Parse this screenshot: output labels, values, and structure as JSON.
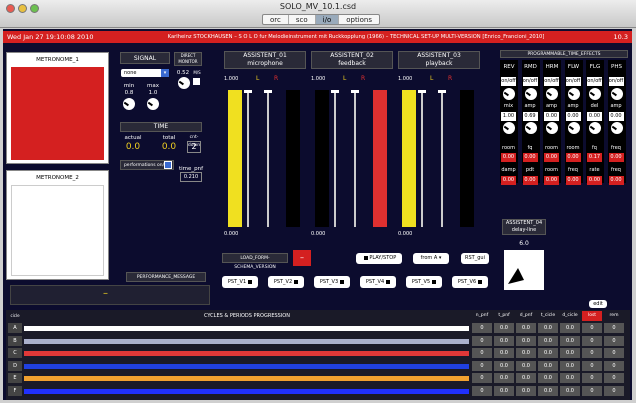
{
  "window": {
    "title": "SOLO_MV_10.1.csd",
    "tabs": [
      "orc",
      "sco",
      "i/o",
      "options"
    ],
    "active_tab": "i/o"
  },
  "header": {
    "date": "Wed Jan 27 19:10:08 2010",
    "title": "Karlheinz STOCKHAUSEN – S O L O  fur Melodieinstrument mit Ruckkopplung (1966) – TECHNICAL SET-UP MULTI-VERSION [Enrico_Francioni_2010]",
    "version": "10.3"
  },
  "metronome1": {
    "label": "METRONOME_1",
    "color": "#d42020"
  },
  "metronome2": {
    "label": "METRONOME_2",
    "color": "#ffffff"
  },
  "signal": {
    "label": "SIGNAL",
    "select": "none",
    "min_label": "min",
    "max_label": "max",
    "min": "0.8",
    "max": "1.0"
  },
  "direct_monitor": {
    "label": "DIRECT MONITOR",
    "value": "0.52",
    "toggle": "M/S"
  },
  "time": {
    "label": "TIME",
    "actual_label": "actual",
    "total_label": "total",
    "countdown_label": "cnt-down",
    "actual": "0.0",
    "total": "0.0",
    "countdown": "2",
    "perf_label": "performations on/off",
    "time_pnf_label": "time_pnf",
    "time_pnf": "0.210"
  },
  "assistants": [
    {
      "title": "ASSISTENT_01",
      "subtitle": "microphone",
      "scale": "1.000",
      "l": "L",
      "r": "R",
      "level": 0
    },
    {
      "title": "ASSISTENT_02",
      "subtitle": "feedback",
      "scale": "1.000",
      "l": "L",
      "r": "R",
      "level": 0
    },
    {
      "title": "ASSISTENT_03",
      "subtitle": "playback",
      "scale": "1.000",
      "l": "L",
      "r": "R",
      "level": 0
    }
  ],
  "meters": {
    "zero": "0.000"
  },
  "fx": {
    "title": "PROGRAMMABLE_TIME_EFFECTS",
    "cols": [
      "REV",
      "RMD",
      "HRM",
      "FLW",
      "FLG",
      "PHS"
    ],
    "r1": [
      "on/off",
      "on/off",
      "on/off",
      "on/off",
      "on/off",
      "on/off"
    ],
    "r2": [
      "mix",
      "amp",
      "amp",
      "amp",
      "del",
      "amp"
    ],
    "r3": [
      "1.00",
      "0.69",
      "0.00",
      "0.00",
      "0.00",
      "0.00"
    ],
    "r4": [
      "room",
      "fq",
      "room",
      "room",
      "fq",
      "freq"
    ],
    "r5": [
      "0.00",
      "0.00",
      "0.00",
      "0.00",
      "0.17",
      "0.00"
    ],
    "r6": [
      "damp",
      "pdt",
      "room",
      "freq",
      "rate",
      "freq"
    ],
    "r7": [
      "0.00",
      "0.00",
      "0.00",
      "0.00",
      "0.00",
      "0.00"
    ]
  },
  "delay": {
    "title": "ASSISTENT_04",
    "subtitle": "delay-line",
    "value": "6.0"
  },
  "load_label": "LOAD_FORM-SCHEMA_VERSION",
  "play_label": "PLAY/STOP",
  "from_label": "from A",
  "rst_label": "RST_gui",
  "presets": [
    "PST_V1",
    "PST_V2",
    "PST_V3",
    "PST_V4",
    "PST_V5",
    "PST_V6"
  ],
  "perf_msg": {
    "label": "PERFORMANCE_MESSAGE",
    "value": "–"
  },
  "edit_label": "edit",
  "table": {
    "head0": "cicle",
    "head1": "CYCLES & PERIODS PROGRESSION",
    "cols": [
      "n_pnf",
      "t_pnf",
      "d_pnf",
      "t_cicle",
      "d_cicle",
      "lost",
      "rem"
    ],
    "rows": [
      {
        "id": "A",
        "color": "#ffffff",
        "vals": [
          "0",
          "0.0",
          "0.0",
          "0.0",
          "0.0",
          "0",
          "0"
        ]
      },
      {
        "id": "B",
        "color": "#aab0cc",
        "vals": [
          "0",
          "0.0",
          "0.0",
          "0.0",
          "0.0",
          "0",
          "0"
        ]
      },
      {
        "id": "C",
        "color": "#e03838",
        "vals": [
          "0",
          "0.0",
          "0.0",
          "0.0",
          "0.0",
          "0",
          "0"
        ]
      },
      {
        "id": "D",
        "color": "#2040e0",
        "vals": [
          "0",
          "0.0",
          "0.0",
          "0.0",
          "0.0",
          "0",
          "0"
        ]
      },
      {
        "id": "E",
        "color": "#f0a030",
        "vals": [
          "0",
          "0.0",
          "0.0",
          "0.0",
          "0.0",
          "0",
          "0"
        ]
      },
      {
        "id": "F",
        "color": "#2030ff",
        "vals": [
          "0",
          "0.0",
          "0.0",
          "0.0",
          "0.0",
          "0",
          "0"
        ]
      }
    ]
  }
}
